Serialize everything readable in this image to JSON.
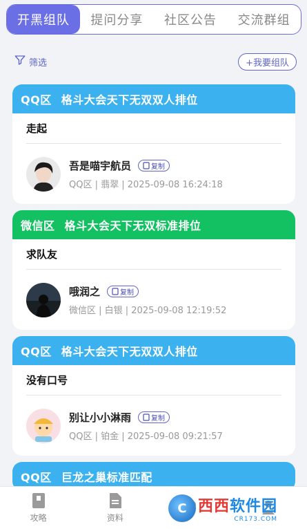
{
  "tabs": [
    {
      "label": "开黑组队",
      "active": true
    },
    {
      "label": "提问分享",
      "active": false
    },
    {
      "label": "社区公告",
      "active": false
    },
    {
      "label": "交流群组",
      "active": false
    }
  ],
  "toolbar": {
    "filter_label": "筛选",
    "team_button": "+我要组队",
    "icon": "filter-icon"
  },
  "colors": {
    "accent": "#6b6fe6",
    "qq": "#3bb2ef",
    "wechat": "#13c162"
  },
  "posts": [
    {
      "zone": "QQ区",
      "mode": "格斗大会天下无双双人排位",
      "text": "走起",
      "user": "吾是喵宇航员",
      "copy_label": "复制",
      "meta": "QQ区 | 翡翠 | 2025-09-08 16:24:18",
      "avatar": "avatar-dark-hair"
    },
    {
      "zone": "微信区",
      "mode": "格斗大会天下无双标准排位",
      "text": "求队友",
      "user": "哦润之",
      "copy_label": "复制",
      "meta": "微信区 | 白银 | 2025-09-08 12:19:52",
      "avatar": "avatar-silhouette"
    },
    {
      "zone": "QQ区",
      "mode": "格斗大会天下无双双人排位",
      "text": "没有口号",
      "user": "别让小小淋雨",
      "copy_label": "复制",
      "meta": "QQ区 | 铂金 | 2025-09-08 09:21:57",
      "avatar": "avatar-cartoon"
    },
    {
      "zone": "QQ区",
      "mode": "巨龙之巢标准匹配"
    }
  ],
  "bottom_nav": [
    {
      "label": "攻略",
      "icon": "book-icon"
    },
    {
      "label": "资料",
      "icon": "document-icon"
    },
    {
      "label": "",
      "icon": "community-icon"
    },
    {
      "label": "",
      "icon": "profile-icon"
    }
  ],
  "watermark": {
    "main_a": "西西",
    "main_b": "软件园",
    "sub": "CR173.COM"
  }
}
